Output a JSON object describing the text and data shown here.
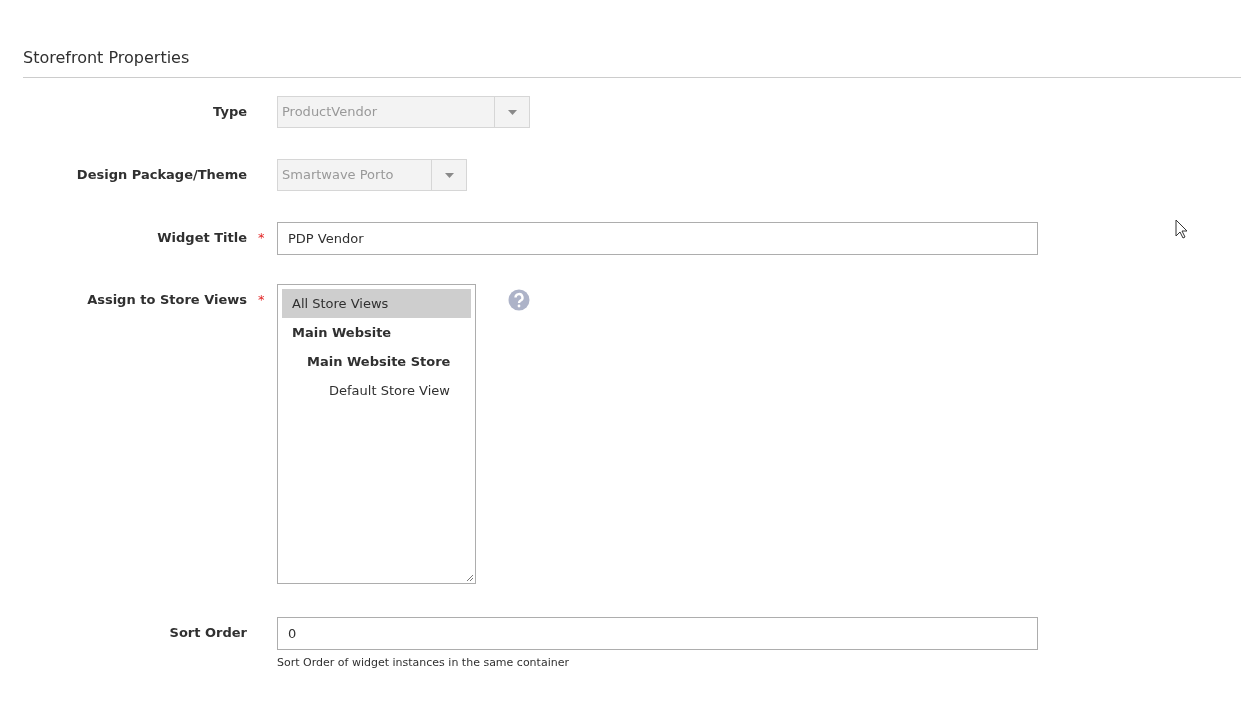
{
  "section": {
    "title": "Storefront Properties"
  },
  "fields": [
    {
      "kind": "select",
      "label": "Type",
      "disabled": true,
      "value": "ProductVendor"
    },
    {
      "kind": "select",
      "label": "Design Package/Theme",
      "disabled": true,
      "value": "Smartwave Porto"
    },
    {
      "kind": "text",
      "label": "Widget Title",
      "required_mark": "*",
      "value": "PDP Vendor"
    },
    {
      "kind": "multiselect",
      "label": "Assign to Store Views",
      "required_mark": "*",
      "help": true,
      "options": [
        {
          "label": "All Store Views",
          "selected": true,
          "group": false
        },
        {
          "label": "Main Website",
          "selected": false,
          "group": true,
          "children": [
            {
              "label": "Main Website Store",
              "selected": false,
              "group": true,
              "children": [
                {
                  "label": "Default Store View",
                  "selected": false,
                  "group": false
                }
              ]
            }
          ]
        }
      ]
    },
    {
      "kind": "text",
      "label": "Sort Order",
      "value": "0",
      "note": "Sort Order of widget instances in the same container"
    }
  ]
}
